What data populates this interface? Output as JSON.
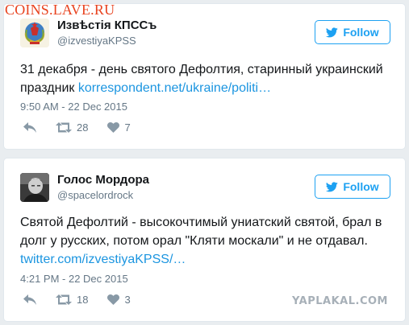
{
  "watermarks": {
    "top": "COINS.LAVE.RU",
    "bottom": "YAPLAKAL.COM"
  },
  "colors": {
    "twitter_blue": "#1da1f2",
    "link_blue": "#1b95e0",
    "watermark_red": "#e8431f"
  },
  "tweets": [
    {
      "name": "Извѣстія КПССъ",
      "handle": "@izvestiyaKPSS",
      "follow_label": "Follow",
      "text": "31 декабря - день святого Дефолтия, старинный украинский праздник ",
      "link": "korrespondent.net/ukraine/politi…",
      "timestamp": "9:50 AM - 22 Dec 2015",
      "retweets": "28",
      "likes": "7",
      "avatar_icon": "coat-of-arms-icon"
    },
    {
      "name": "Голос Мордора",
      "handle": "@spacelordrock",
      "follow_label": "Follow",
      "text": "Святой Дефолтий - высокочтимый униатский святой, брал в долг у русских, потом орал \"Кляти москали\" и не отдавал. ",
      "link": "twitter.com/izvestiyaKPSS/…",
      "timestamp": "4:21 PM - 22 Dec 2015",
      "retweets": "18",
      "likes": "3",
      "avatar_icon": "person-photo-icon"
    }
  ]
}
